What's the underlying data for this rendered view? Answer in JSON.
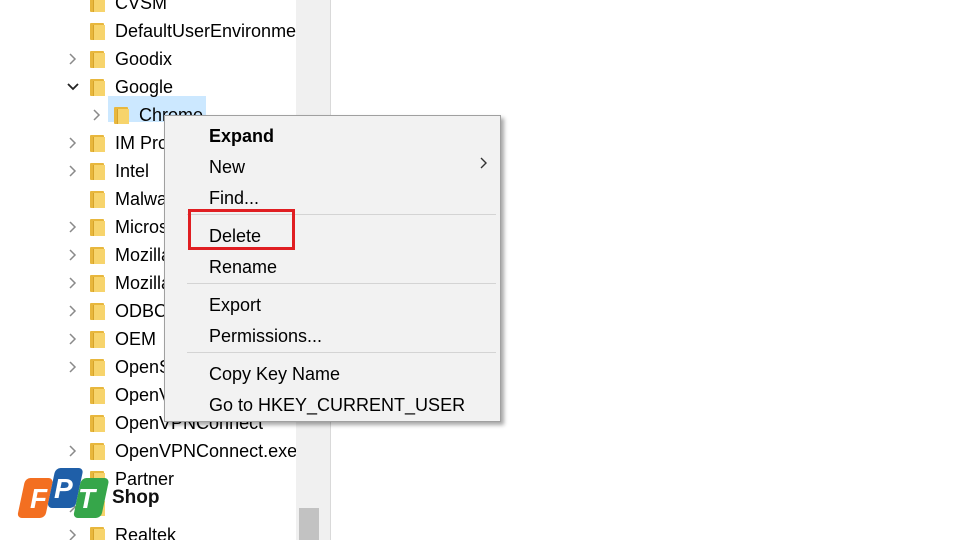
{
  "tree": {
    "items": [
      {
        "label": "CVSM",
        "expander": "none"
      },
      {
        "label": "DefaultUserEnvironmen",
        "expander": "none"
      },
      {
        "label": "Goodix",
        "expander": "collapsed"
      },
      {
        "label": "Google",
        "expander": "expanded"
      },
      {
        "label": "Chrome",
        "expander": "collapsed",
        "child": true,
        "selected": true
      },
      {
        "label": "IM Pro",
        "expander": "collapsed"
      },
      {
        "label": "Intel",
        "expander": "collapsed"
      },
      {
        "label": "Malwa",
        "expander": "none"
      },
      {
        "label": "Micros",
        "expander": "collapsed"
      },
      {
        "label": "Mozilla",
        "expander": "collapsed"
      },
      {
        "label": "Mozilla",
        "expander": "collapsed"
      },
      {
        "label": "ODBC",
        "expander": "collapsed"
      },
      {
        "label": "OEM",
        "expander": "collapsed"
      },
      {
        "label": "OpenS",
        "expander": "collapsed"
      },
      {
        "label": "OpenV",
        "expander": "none"
      },
      {
        "label": "OpenVPNConnect",
        "expander": "none"
      },
      {
        "label": "OpenVPNConnect.exe",
        "expander": "collapsed"
      },
      {
        "label": "Partner",
        "expander": "none"
      },
      {
        "label": "",
        "expander": "collapsed"
      },
      {
        "label": "Realtek",
        "expander": "collapsed"
      }
    ]
  },
  "context_menu": {
    "items": [
      {
        "label": "Expand",
        "bold": true
      },
      {
        "label": "New",
        "submenu": true
      },
      {
        "label": "Find..."
      },
      {
        "label": "Delete",
        "highlighted": true
      },
      {
        "label": "Rename"
      },
      {
        "label": "Export"
      },
      {
        "label": "Permissions..."
      },
      {
        "label": "Copy Key Name"
      },
      {
        "label": "Go to HKEY_CURRENT_USER"
      }
    ]
  },
  "watermark": {
    "logo_letters": "FPT",
    "shop_label": "Shop"
  },
  "colors": {
    "highlight_border": "#e01e22",
    "selection": "#cce8ff",
    "folder": "#f7d46c",
    "logo_orange": "#f36f21",
    "logo_blue": "#1f5fa8",
    "logo_green": "#36a64a"
  }
}
